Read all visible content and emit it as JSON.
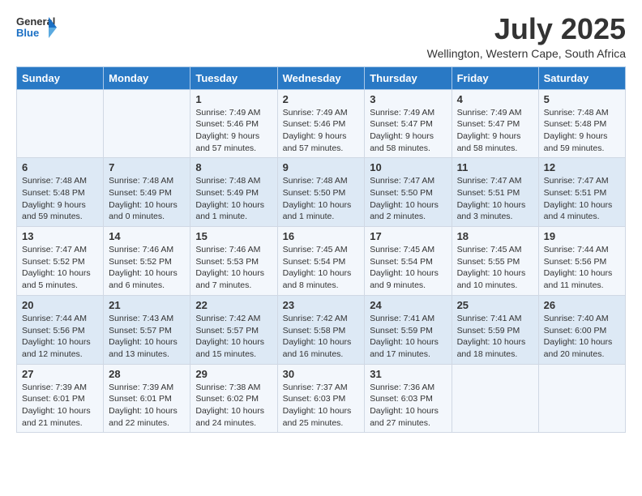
{
  "logo": {
    "general": "General",
    "blue": "Blue"
  },
  "title": "July 2025",
  "subtitle": "Wellington, Western Cape, South Africa",
  "days_of_week": [
    "Sunday",
    "Monday",
    "Tuesday",
    "Wednesday",
    "Thursday",
    "Friday",
    "Saturday"
  ],
  "weeks": [
    [
      {
        "day": "",
        "info": ""
      },
      {
        "day": "",
        "info": ""
      },
      {
        "day": "1",
        "info": "Sunrise: 7:49 AM\nSunset: 5:46 PM\nDaylight: 9 hours and 57 minutes."
      },
      {
        "day": "2",
        "info": "Sunrise: 7:49 AM\nSunset: 5:46 PM\nDaylight: 9 hours and 57 minutes."
      },
      {
        "day": "3",
        "info": "Sunrise: 7:49 AM\nSunset: 5:47 PM\nDaylight: 9 hours and 58 minutes."
      },
      {
        "day": "4",
        "info": "Sunrise: 7:49 AM\nSunset: 5:47 PM\nDaylight: 9 hours and 58 minutes."
      },
      {
        "day": "5",
        "info": "Sunrise: 7:48 AM\nSunset: 5:48 PM\nDaylight: 9 hours and 59 minutes."
      }
    ],
    [
      {
        "day": "6",
        "info": "Sunrise: 7:48 AM\nSunset: 5:48 PM\nDaylight: 9 hours and 59 minutes."
      },
      {
        "day": "7",
        "info": "Sunrise: 7:48 AM\nSunset: 5:49 PM\nDaylight: 10 hours and 0 minutes."
      },
      {
        "day": "8",
        "info": "Sunrise: 7:48 AM\nSunset: 5:49 PM\nDaylight: 10 hours and 1 minute."
      },
      {
        "day": "9",
        "info": "Sunrise: 7:48 AM\nSunset: 5:50 PM\nDaylight: 10 hours and 1 minute."
      },
      {
        "day": "10",
        "info": "Sunrise: 7:47 AM\nSunset: 5:50 PM\nDaylight: 10 hours and 2 minutes."
      },
      {
        "day": "11",
        "info": "Sunrise: 7:47 AM\nSunset: 5:51 PM\nDaylight: 10 hours and 3 minutes."
      },
      {
        "day": "12",
        "info": "Sunrise: 7:47 AM\nSunset: 5:51 PM\nDaylight: 10 hours and 4 minutes."
      }
    ],
    [
      {
        "day": "13",
        "info": "Sunrise: 7:47 AM\nSunset: 5:52 PM\nDaylight: 10 hours and 5 minutes."
      },
      {
        "day": "14",
        "info": "Sunrise: 7:46 AM\nSunset: 5:52 PM\nDaylight: 10 hours and 6 minutes."
      },
      {
        "day": "15",
        "info": "Sunrise: 7:46 AM\nSunset: 5:53 PM\nDaylight: 10 hours and 7 minutes."
      },
      {
        "day": "16",
        "info": "Sunrise: 7:45 AM\nSunset: 5:54 PM\nDaylight: 10 hours and 8 minutes."
      },
      {
        "day": "17",
        "info": "Sunrise: 7:45 AM\nSunset: 5:54 PM\nDaylight: 10 hours and 9 minutes."
      },
      {
        "day": "18",
        "info": "Sunrise: 7:45 AM\nSunset: 5:55 PM\nDaylight: 10 hours and 10 minutes."
      },
      {
        "day": "19",
        "info": "Sunrise: 7:44 AM\nSunset: 5:56 PM\nDaylight: 10 hours and 11 minutes."
      }
    ],
    [
      {
        "day": "20",
        "info": "Sunrise: 7:44 AM\nSunset: 5:56 PM\nDaylight: 10 hours and 12 minutes."
      },
      {
        "day": "21",
        "info": "Sunrise: 7:43 AM\nSunset: 5:57 PM\nDaylight: 10 hours and 13 minutes."
      },
      {
        "day": "22",
        "info": "Sunrise: 7:42 AM\nSunset: 5:57 PM\nDaylight: 10 hours and 15 minutes."
      },
      {
        "day": "23",
        "info": "Sunrise: 7:42 AM\nSunset: 5:58 PM\nDaylight: 10 hours and 16 minutes."
      },
      {
        "day": "24",
        "info": "Sunrise: 7:41 AM\nSunset: 5:59 PM\nDaylight: 10 hours and 17 minutes."
      },
      {
        "day": "25",
        "info": "Sunrise: 7:41 AM\nSunset: 5:59 PM\nDaylight: 10 hours and 18 minutes."
      },
      {
        "day": "26",
        "info": "Sunrise: 7:40 AM\nSunset: 6:00 PM\nDaylight: 10 hours and 20 minutes."
      }
    ],
    [
      {
        "day": "27",
        "info": "Sunrise: 7:39 AM\nSunset: 6:01 PM\nDaylight: 10 hours and 21 minutes."
      },
      {
        "day": "28",
        "info": "Sunrise: 7:39 AM\nSunset: 6:01 PM\nDaylight: 10 hours and 22 minutes."
      },
      {
        "day": "29",
        "info": "Sunrise: 7:38 AM\nSunset: 6:02 PM\nDaylight: 10 hours and 24 minutes."
      },
      {
        "day": "30",
        "info": "Sunrise: 7:37 AM\nSunset: 6:03 PM\nDaylight: 10 hours and 25 minutes."
      },
      {
        "day": "31",
        "info": "Sunrise: 7:36 AM\nSunset: 6:03 PM\nDaylight: 10 hours and 27 minutes."
      },
      {
        "day": "",
        "info": ""
      },
      {
        "day": "",
        "info": ""
      }
    ]
  ]
}
